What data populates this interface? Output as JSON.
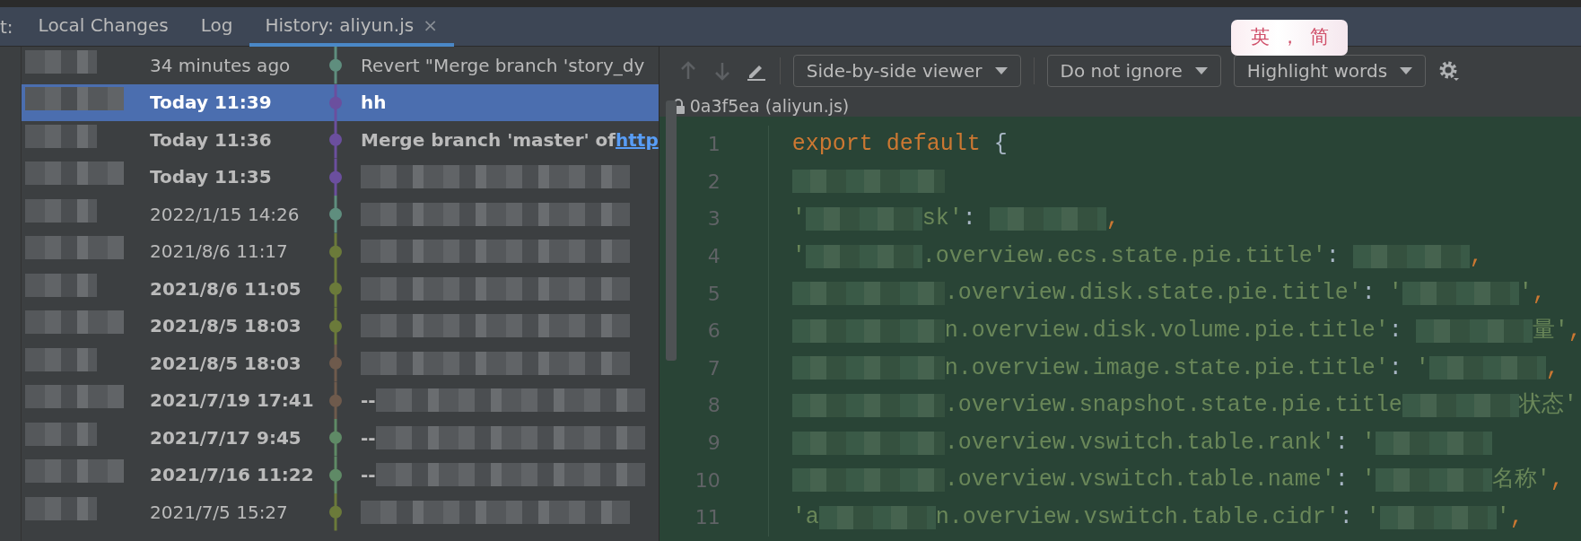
{
  "tool_window": {
    "label": "t:"
  },
  "tabs": [
    {
      "label": "Local Changes",
      "selected": false,
      "closable": false
    },
    {
      "label": "Log",
      "selected": false,
      "closable": false
    },
    {
      "label": "History: aliyun.js",
      "selected": true,
      "closable": true,
      "close": "×"
    }
  ],
  "ime": {
    "items": [
      "英",
      "，",
      "简"
    ]
  },
  "history": [
    {
      "date": "34 minutes ago",
      "bold": false,
      "selected": false,
      "color": "#5f8e7e",
      "message": [
        {
          "kind": "text",
          "text": "Revert \"Merge branch 'story_dy"
        }
      ]
    },
    {
      "date": "Today 11:39",
      "bold": true,
      "selected": true,
      "color": "#6b4f9e",
      "message": [
        {
          "kind": "text",
          "text": "hh"
        }
      ]
    },
    {
      "date": "Today 11:36",
      "bold": true,
      "selected": false,
      "color": "#6b4f9e",
      "message": [
        {
          "kind": "text",
          "text": "Merge branch 'master' of "
        },
        {
          "kind": "link",
          "text": "http"
        }
      ]
    },
    {
      "date": "Today 11:35",
      "bold": true,
      "selected": false,
      "color": "#6b4f9e",
      "message": [
        {
          "kind": "blur"
        }
      ]
    },
    {
      "date": "2022/1/15 14:26",
      "bold": false,
      "selected": false,
      "color": "#5f8e7e",
      "message": [
        {
          "kind": "blur"
        }
      ]
    },
    {
      "date": "2021/8/6 11:17",
      "bold": false,
      "selected": false,
      "color": "#6b7a3a",
      "message": [
        {
          "kind": "blur"
        }
      ]
    },
    {
      "date": "2021/8/6 11:05",
      "bold": true,
      "selected": false,
      "color": "#6b7a3a",
      "message": [
        {
          "kind": "blur"
        }
      ]
    },
    {
      "date": "2021/8/5 18:03",
      "bold": true,
      "selected": false,
      "color": "#6b7a3a",
      "message": [
        {
          "kind": "blur"
        }
      ]
    },
    {
      "date": "2021/8/5 18:03",
      "bold": true,
      "selected": false,
      "color": "#6e5a4c",
      "message": [
        {
          "kind": "blur"
        }
      ]
    },
    {
      "date": "2021/7/19 17:41",
      "bold": true,
      "selected": false,
      "color": "#6e5a4c",
      "message": [
        {
          "kind": "text",
          "text": "--"
        },
        {
          "kind": "blur"
        }
      ]
    },
    {
      "date": "2021/7/17 9:45",
      "bold": true,
      "selected": false,
      "color": "#5f8a66",
      "message": [
        {
          "kind": "text",
          "text": "--"
        },
        {
          "kind": "blur"
        }
      ]
    },
    {
      "date": "2021/7/16 11:22",
      "bold": true,
      "selected": false,
      "color": "#5f8a66",
      "message": [
        {
          "kind": "text",
          "text": "--"
        },
        {
          "kind": "blur"
        }
      ]
    },
    {
      "date": "2021/7/5 15:27",
      "bold": false,
      "selected": false,
      "color": "#6b7a3a",
      "message": [
        {
          "kind": "blur"
        }
      ]
    }
  ],
  "viewer": {
    "dropdowns": [
      {
        "label": "Side-by-side viewer"
      },
      {
        "label": "Do not ignore"
      },
      {
        "label": "Highlight words"
      }
    ],
    "file": "0a3f5ea (aliyun.js)",
    "lines": [
      {
        "number": "1",
        "code": [
          {
            "kind": "keyword",
            "text": "export default"
          },
          {
            "kind": "punct",
            "text": " {"
          }
        ]
      },
      {
        "number": "2",
        "code": [
          {
            "kind": "blur"
          }
        ]
      },
      {
        "number": "3",
        "code": [
          {
            "kind": "string",
            "text": "'"
          },
          {
            "kind": "blur"
          },
          {
            "kind": "string",
            "text": "sk'"
          },
          {
            "kind": "punct",
            "text": ": "
          },
          {
            "kind": "blur"
          },
          {
            "kind": "comma",
            "text": ","
          }
        ]
      },
      {
        "number": "4",
        "code": [
          {
            "kind": "string",
            "text": "'"
          },
          {
            "kind": "blur"
          },
          {
            "kind": "string",
            "text": ".overview.ecs.state.pie.title'"
          },
          {
            "kind": "punct",
            "text": ": "
          },
          {
            "kind": "blur"
          },
          {
            "kind": "comma",
            "text": ","
          }
        ]
      },
      {
        "number": "5",
        "code": [
          {
            "kind": "blur"
          },
          {
            "kind": "string",
            "text": ".overview.disk.state.pie.title'"
          },
          {
            "kind": "punct",
            "text": ": "
          },
          {
            "kind": "string",
            "text": "'"
          },
          {
            "kind": "blur"
          },
          {
            "kind": "string",
            "text": "'"
          },
          {
            "kind": "comma",
            "text": ","
          }
        ]
      },
      {
        "number": "6",
        "code": [
          {
            "kind": "blur"
          },
          {
            "kind": "string",
            "text": "n.overview.disk.volume.pie.title'"
          },
          {
            "kind": "punct",
            "text": ": "
          },
          {
            "kind": "blur"
          },
          {
            "kind": "string",
            "text": "量'"
          },
          {
            "kind": "comma",
            "text": ","
          }
        ]
      },
      {
        "number": "7",
        "code": [
          {
            "kind": "blur"
          },
          {
            "kind": "string",
            "text": "n.overview.image.state.pie.title'"
          },
          {
            "kind": "punct",
            "text": ": "
          },
          {
            "kind": "string",
            "text": "'"
          },
          {
            "kind": "blur"
          },
          {
            "kind": "comma",
            "text": ","
          }
        ]
      },
      {
        "number": "8",
        "code": [
          {
            "kind": "blur"
          },
          {
            "kind": "string",
            "text": ".overview.snapshot.state.pie.title"
          },
          {
            "kind": "blur"
          },
          {
            "kind": "string",
            "text": "状态'"
          }
        ]
      },
      {
        "number": "9",
        "code": [
          {
            "kind": "blur"
          },
          {
            "kind": "string",
            "text": ".overview.vswitch.table.rank'"
          },
          {
            "kind": "punct",
            "text": ": "
          },
          {
            "kind": "string",
            "text": "'"
          },
          {
            "kind": "blur"
          }
        ]
      },
      {
        "number": "10",
        "code": [
          {
            "kind": "blur"
          },
          {
            "kind": "string",
            "text": ".overview.vswitch.table.name'"
          },
          {
            "kind": "punct",
            "text": ": "
          },
          {
            "kind": "string",
            "text": "'"
          },
          {
            "kind": "blur"
          },
          {
            "kind": "string",
            "text": "名称'"
          },
          {
            "kind": "comma",
            "text": ","
          }
        ]
      },
      {
        "number": "11",
        "code": [
          {
            "kind": "string",
            "text": "'a"
          },
          {
            "kind": "blur"
          },
          {
            "kind": "string",
            "text": "n.overview.vswitch.table.cidr'"
          },
          {
            "kind": "punct",
            "text": ": "
          },
          {
            "kind": "string",
            "text": "'"
          },
          {
            "kind": "blur"
          },
          {
            "kind": "string",
            "text": "'"
          },
          {
            "kind": "comma",
            "text": ","
          }
        ]
      }
    ]
  }
}
